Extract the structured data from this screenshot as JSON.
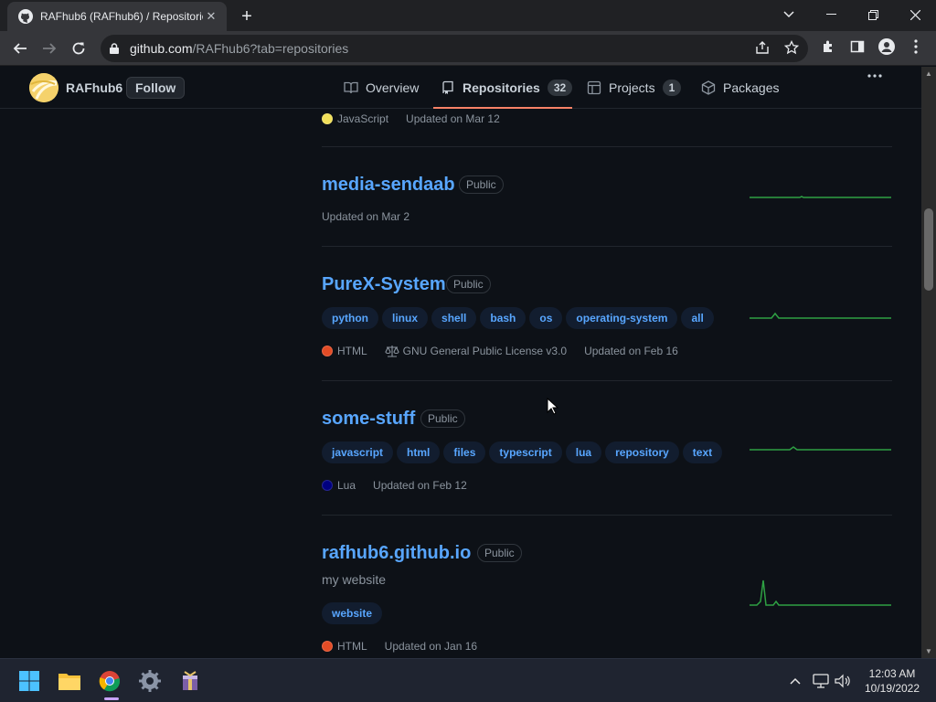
{
  "browser": {
    "tab_title": "RAFhub6 (RAFhub6) / Repositories",
    "url_host": "github.com",
    "url_path": "/RAFhub6?tab=repositories"
  },
  "header": {
    "username": "RAFhub6",
    "follow_label": "Follow",
    "tabs": [
      {
        "label": "Overview",
        "icon": "book-icon"
      },
      {
        "label": "Repositories",
        "icon": "repo-icon",
        "count": "32"
      },
      {
        "label": "Projects",
        "icon": "table-icon",
        "count": "1"
      },
      {
        "label": "Packages",
        "icon": "package-icon"
      }
    ]
  },
  "repos": [
    {
      "language": "JavaScript",
      "language_color": "#f1e05a",
      "updated": "Updated on Mar 12"
    },
    {
      "name": "media-sendaab",
      "visibility": "Public",
      "updated": "Updated on Mar 2"
    },
    {
      "name": "PureX-System",
      "visibility": "Public",
      "topics": [
        "python",
        "linux",
        "shell",
        "bash",
        "os",
        "operating-system",
        "all"
      ],
      "language": "HTML",
      "language_color": "#e34c26",
      "license": "GNU General Public License v3.0",
      "updated": "Updated on Feb 16"
    },
    {
      "name": "some-stuff",
      "visibility": "Public",
      "topics": [
        "javascript",
        "html",
        "files",
        "typescript",
        "lua",
        "repository",
        "text"
      ],
      "language": "Lua",
      "language_color": "#000080",
      "updated": "Updated on Feb 12"
    },
    {
      "name": "rafhub6.github.io",
      "visibility": "Public",
      "description": "my website",
      "topics": [
        "website"
      ],
      "language": "HTML",
      "language_color": "#e34c26",
      "updated": "Updated on Jan 16"
    }
  ],
  "taskbar": {
    "time": "12:03 AM",
    "date": "10/19/2022"
  },
  "colors": {
    "link": "#58a6ff",
    "spark": "#2ea043",
    "tab_underline": "#f78166"
  }
}
